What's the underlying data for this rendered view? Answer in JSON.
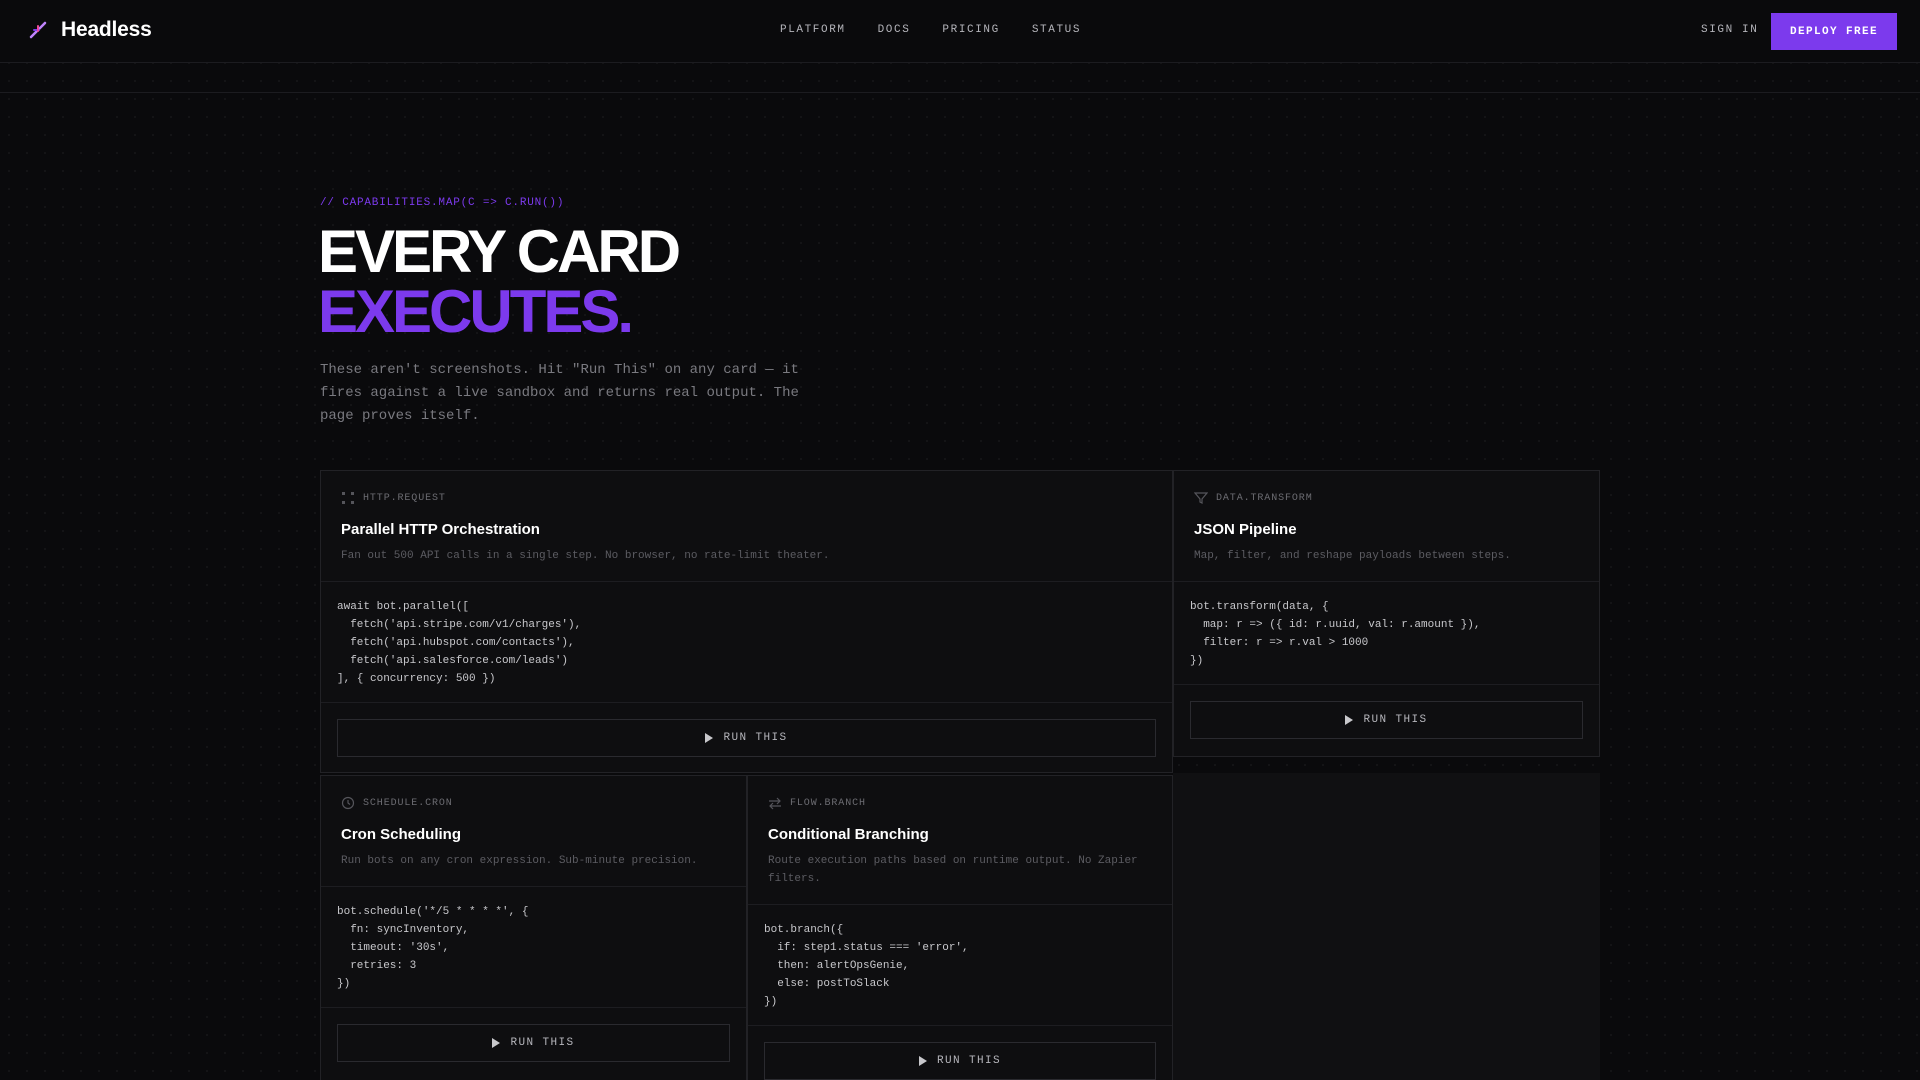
{
  "brand": {
    "name": "Headless"
  },
  "nav": {
    "links": [
      "PLATFORM",
      "DOCS",
      "PRICING",
      "STATUS"
    ],
    "sign_in": "SIGN IN",
    "deploy": "DEPLOY FREE"
  },
  "hero": {
    "kicker": "// CAPABILITIES.MAP(C => C.RUN())",
    "line1": "EVERY CARD",
    "line2": "EXECUTES.",
    "description": "These aren't screenshots. Hit \"Run This\" on any card — it fires against a live sandbox and returns real output. The page proves itself."
  },
  "cards": [
    {
      "tag": "HTTP.REQUEST",
      "icon": "grid-icon",
      "title": "Parallel HTTP Orchestration",
      "description": "Fan out 500 API calls in a single step. No browser, no rate-limit theater.",
      "code": "await bot.parallel([\n  fetch('api.stripe.com/v1/charges'),\n  fetch('api.hubspot.com/contacts'),\n  fetch('api.salesforce.com/leads')\n], { concurrency: 500 })",
      "run_label": "RUN THIS"
    },
    {
      "tag": "DATA.TRANSFORM",
      "icon": "filter-icon",
      "title": "JSON Pipeline",
      "description": "Map, filter, and reshape payloads between steps.",
      "code": "bot.transform(data, {\n  map: r => ({ id: r.uuid, val: r.amount }),\n  filter: r => r.val > 1000\n})",
      "run_label": "RUN THIS"
    },
    {
      "tag": "SCHEDULE.CRON",
      "icon": "clock-icon",
      "title": "Cron Scheduling",
      "description": "Run bots on any cron expression. Sub-minute precision.",
      "code": "bot.schedule('*/5 * * * *', {\n  fn: syncInventory,\n  timeout: '30s',\n  retries: 3\n})",
      "run_label": "RUN THIS"
    },
    {
      "tag": "FLOW.BRANCH",
      "icon": "branch-icon",
      "title": "Conditional Branching",
      "description": "Route execution paths based on runtime output. No Zapier filters.",
      "code": "bot.branch({\n  if: step1.status === 'error',\n  then: alertOpsGenie,\n  else: postToSlack\n})",
      "run_label": "RUN THIS"
    }
  ],
  "colors": {
    "accent": "#7c3aed",
    "background": "#0a0a0c"
  }
}
